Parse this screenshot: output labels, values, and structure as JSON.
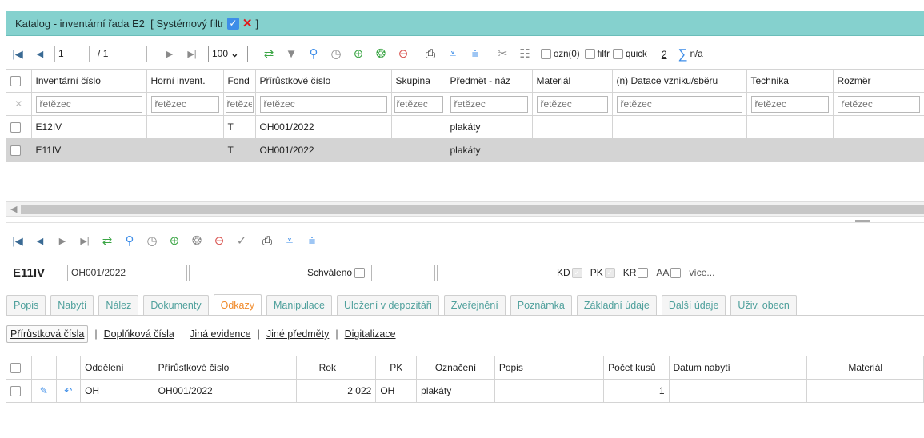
{
  "window": {
    "title": "Katalog - inventární řada E2",
    "filter_label": "[ Systémový filtr",
    "filter_check": "✓",
    "filter_close": "✕",
    "filter_end": "]"
  },
  "top_toolbar": {
    "page_current": "1",
    "page_sep": "/",
    "page_total": "1",
    "page_size": "100",
    "ozn_label": "ozn(0)",
    "filtr_label": "filtr",
    "quick_label": "quick",
    "count_link": "2",
    "sum_label": "n/a"
  },
  "main_grid": {
    "columns": [
      "Inventární číslo",
      "Horní invent.",
      "Fond",
      "Přírůstkové číslo",
      "Skupina",
      "Předmět - náz",
      "Materiál",
      "(n) Datace vzniku/sběru",
      "Technika",
      "Rozměr"
    ],
    "filter_placeholder": "řetězec",
    "rows": [
      {
        "inv": "E12IV",
        "horni": "",
        "fond": "T",
        "prir": "OH001/2022",
        "skupina": "",
        "predmet": "plakáty",
        "material": "",
        "datace": "",
        "technika": "",
        "rozmer": ""
      },
      {
        "inv": "E11IV",
        "horni": "",
        "fond": "T",
        "prir": "OH001/2022",
        "skupina": "",
        "predmet": "plakáty",
        "material": "",
        "datace": "",
        "technika": "",
        "rozmer": ""
      }
    ],
    "selected_row": 1
  },
  "detail": {
    "inv": "E11IV",
    "prir": "OH001/2022",
    "schvaleno_label": "Schváleno",
    "kd_label": "KD",
    "pk_label": "PK",
    "kr_label": "KR",
    "aa_label": "AA",
    "more_link": "více..."
  },
  "tabs": [
    "Popis",
    "Nabytí",
    "Nález",
    "Dokumenty",
    "Odkazy",
    "Manipulace",
    "Uložení v depozitáři",
    "Zveřejnění",
    "Poznámka",
    "Základní údaje",
    "Další údaje",
    "Uživ. obecn"
  ],
  "active_tab": "Odkazy",
  "sublinks": [
    "Přírůstková čísla",
    "Doplňková čísla",
    "Jiná evidence",
    "Jiné předměty",
    "Digitalizace"
  ],
  "sub_grid": {
    "columns": [
      "Oddělení",
      "Přírůstkové číslo",
      "Rok",
      "PK",
      "Označení",
      "Popis",
      "Počet kusů",
      "Datum nabytí",
      "Materiál"
    ],
    "rows": [
      {
        "oddeleni": "OH",
        "prir": "OH001/2022",
        "rok": "2 022",
        "pk": "OH",
        "oznaceni": "plakáty",
        "popis": "",
        "pocet": "1",
        "datum": "",
        "material": ""
      }
    ]
  },
  "colors": {
    "titlebar": "#85d1ce",
    "tab_text": "#4fa09c",
    "active_tab_text": "#f08a2a",
    "selected_row": "#d4d4d4"
  }
}
